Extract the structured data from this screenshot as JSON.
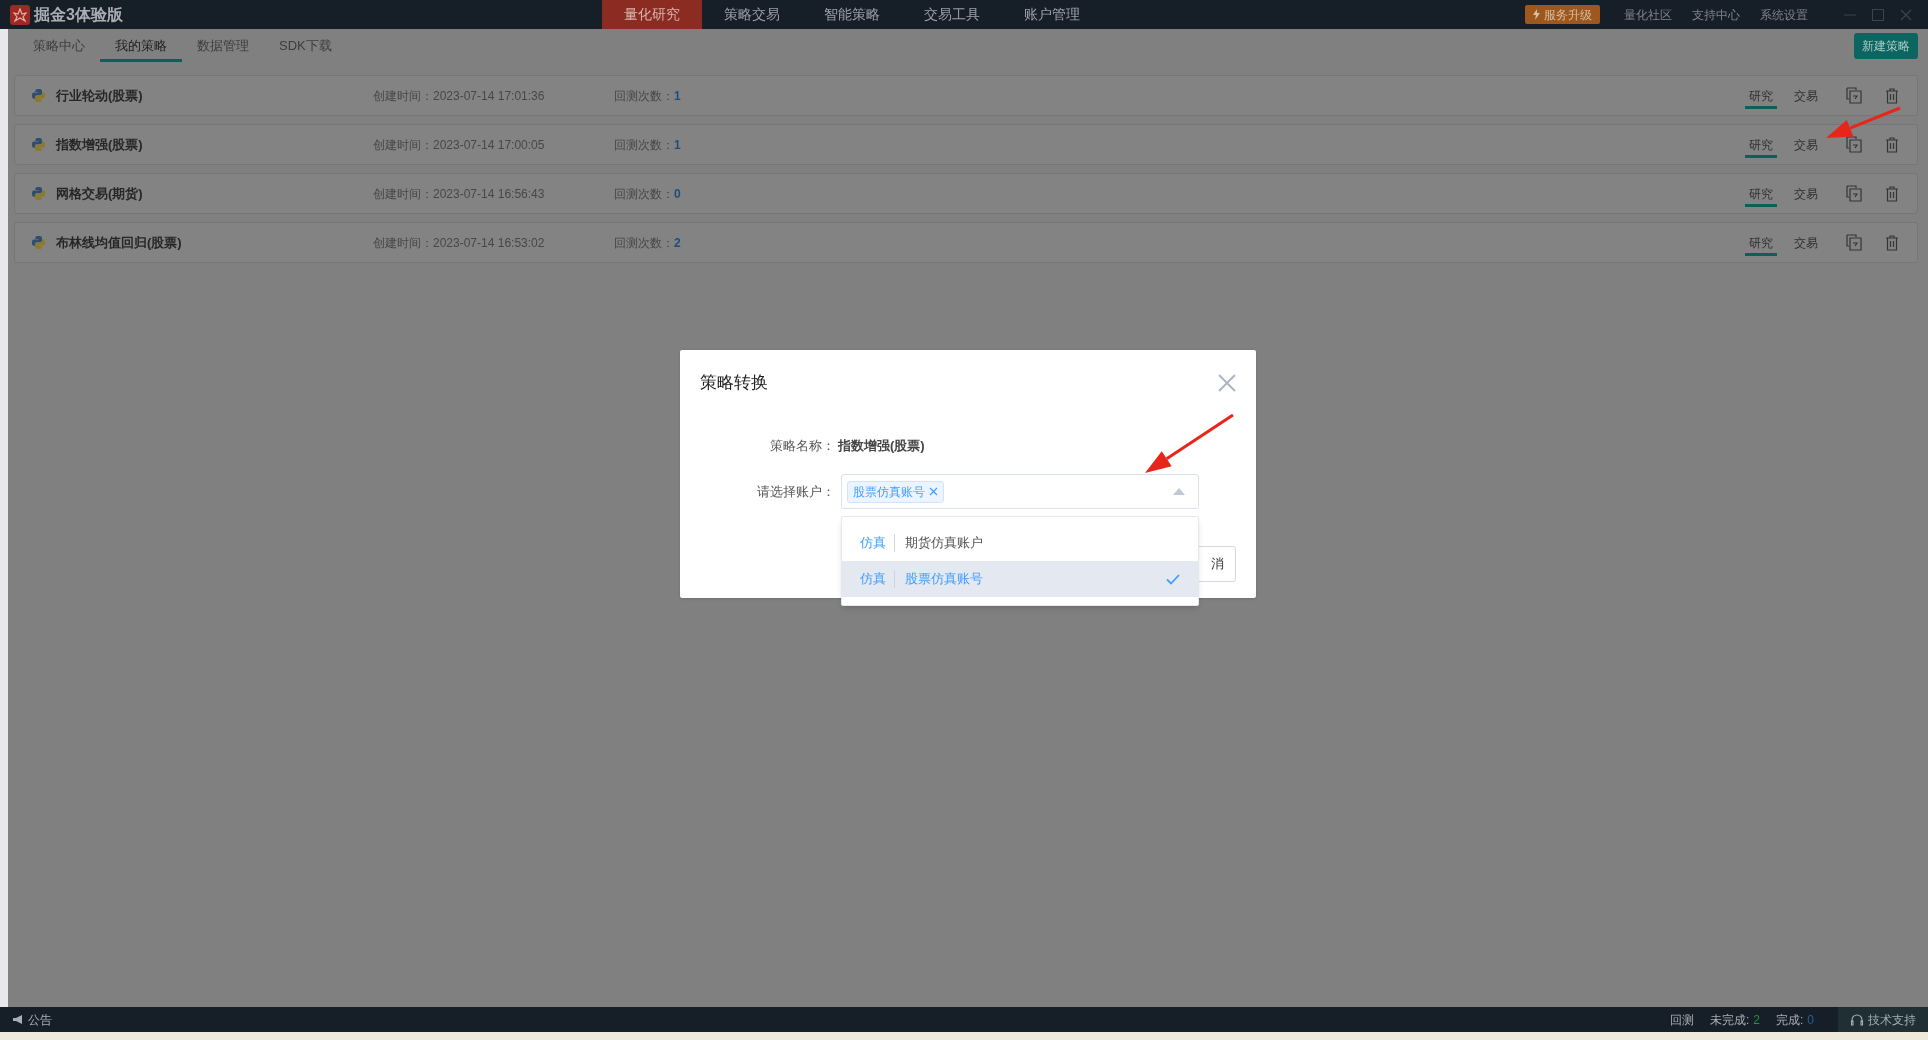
{
  "app": {
    "title": "掘金3体验版"
  },
  "nav": [
    {
      "label": "量化研究",
      "selected": true
    },
    {
      "label": "策略交易",
      "selected": false
    },
    {
      "label": "智能策略",
      "selected": false
    },
    {
      "label": "交易工具",
      "selected": false
    },
    {
      "label": "账户管理",
      "selected": false
    }
  ],
  "upgrade_button": "服务升级",
  "links": [
    "量化社区",
    "支持中心",
    "系统设置"
  ],
  "subtabs": [
    {
      "label": "策略中心",
      "selected": false
    },
    {
      "label": "我的策略",
      "selected": true
    },
    {
      "label": "数据管理",
      "selected": false
    },
    {
      "label": "SDK下载",
      "selected": false
    }
  ],
  "new_button": "新建策略",
  "strategies": [
    {
      "name": "行业轮动(股票)",
      "created_label": "创建时间：",
      "created": "2023-07-14 17:01:36",
      "count_label": "回测次数：",
      "count": "1",
      "modes": [
        {
          "label": "研究",
          "selected": true
        },
        {
          "label": "交易",
          "selected": false
        }
      ]
    },
    {
      "name": "指数增强(股票)",
      "created_label": "创建时间：",
      "created": "2023-07-14 17:00:05",
      "count_label": "回测次数：",
      "count": "1",
      "modes": [
        {
          "label": "研究",
          "selected": true
        },
        {
          "label": "交易",
          "selected": false
        }
      ]
    },
    {
      "name": "网格交易(期货)",
      "created_label": "创建时间：",
      "created": "2023-07-14 16:56:43",
      "count_label": "回测次数：",
      "count": "0",
      "modes": [
        {
          "label": "研究",
          "selected": true
        },
        {
          "label": "交易",
          "selected": false
        }
      ]
    },
    {
      "name": "布林线均值回归(股票)",
      "created_label": "创建时间：",
      "created": "2023-07-14 16:53:02",
      "count_label": "回测次数：",
      "count": "2",
      "modes": [
        {
          "label": "研究",
          "selected": true
        },
        {
          "label": "交易",
          "selected": false
        }
      ]
    }
  ],
  "dialog": {
    "title": "策略转换",
    "name_label": "策略名称：",
    "name_value": "指数增强(股票)",
    "account_label": "请选择账户：",
    "tags": [
      "股票仿真账号"
    ],
    "options": [
      {
        "type": "仿真",
        "label": "期货仿真账户",
        "selected": false
      },
      {
        "type": "仿真",
        "label": "股票仿真账号",
        "selected": true
      }
    ],
    "cancel_button": "消"
  },
  "status_bar": {
    "notice": "公告",
    "backtest": "回测",
    "pending_label": "未完成:",
    "pending": "2",
    "done_label": "完成:",
    "done": "0",
    "support": "技术支持"
  }
}
